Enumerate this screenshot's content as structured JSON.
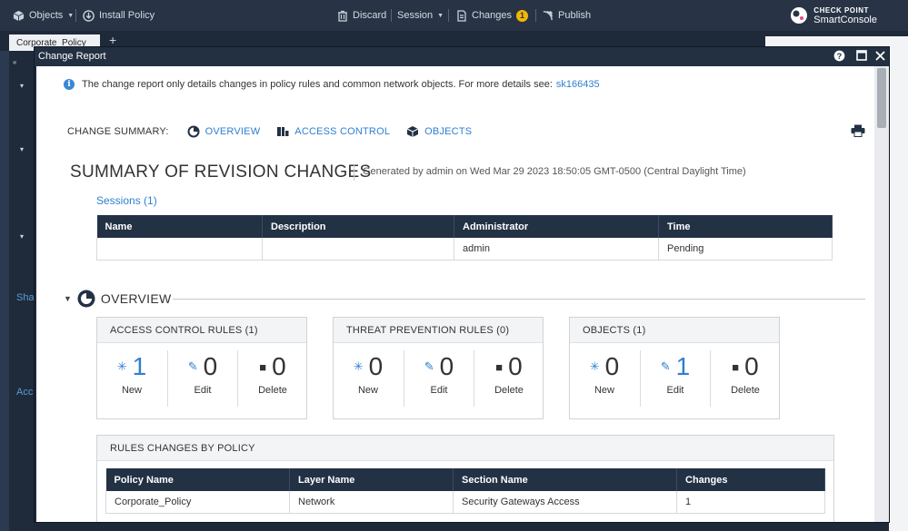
{
  "topbar": {
    "objects_label": "Objects",
    "install_policy_label": "Install Policy",
    "discard_label": "Discard",
    "session_label": "Session",
    "changes_label": "Changes",
    "changes_count": "1",
    "publish_label": "Publish",
    "brand_top": "CHECK POINT",
    "brand_bottom": "SmartConsole"
  },
  "background": {
    "policy_tab": "Corporate_Policy",
    "left_text_1": "Sha",
    "left_text_2": "Acc"
  },
  "modal": {
    "title": "Change Report",
    "info_text": "The change report only details changes in policy rules and common network objects. For more details see:",
    "info_link": "sk166435",
    "summary_label": "CHANGE SUMMARY:",
    "nav": {
      "overview": "OVERVIEW",
      "access_control": "ACCESS CONTROL",
      "objects": "OBJECTS"
    },
    "revision_title": "SUMMARY OF REVISION CHANGES",
    "generated_by": "Generated by admin on Wed Mar 29 2023 18:50:05 GMT-0500 (Central Daylight Time)",
    "sessions_label": "Sessions (1)",
    "sessions_table": {
      "headers": [
        "Name",
        "Description",
        "Administrator",
        "Time"
      ],
      "rows": [
        [
          "",
          "",
          "admin",
          "Pending"
        ]
      ]
    },
    "overview_title": "OVERVIEW",
    "cards": [
      {
        "title": "ACCESS CONTROL RULES (1)",
        "new": "1",
        "edit": "0",
        "delete": "0"
      },
      {
        "title": "THREAT PREVENTION RULES (0)",
        "new": "0",
        "edit": "0",
        "delete": "0"
      },
      {
        "title": "OBJECTS (1)",
        "new": "0",
        "edit": "1",
        "delete": "0"
      }
    ],
    "stat_labels": {
      "new": "New",
      "edit": "Edit",
      "delete": "Delete"
    },
    "rules_by_policy": {
      "title": "RULES CHANGES BY POLICY",
      "headers": [
        "Policy Name",
        "Layer Name",
        "Section Name",
        "Changes"
      ],
      "rows": [
        [
          "Corporate_Policy",
          "Network",
          "Security Gateways Access",
          "1"
        ]
      ]
    }
  },
  "colors": {
    "accent": "#2f7fd0",
    "header_dark": "#233145",
    "topbar": "#283445",
    "badge": "#f2b705"
  }
}
